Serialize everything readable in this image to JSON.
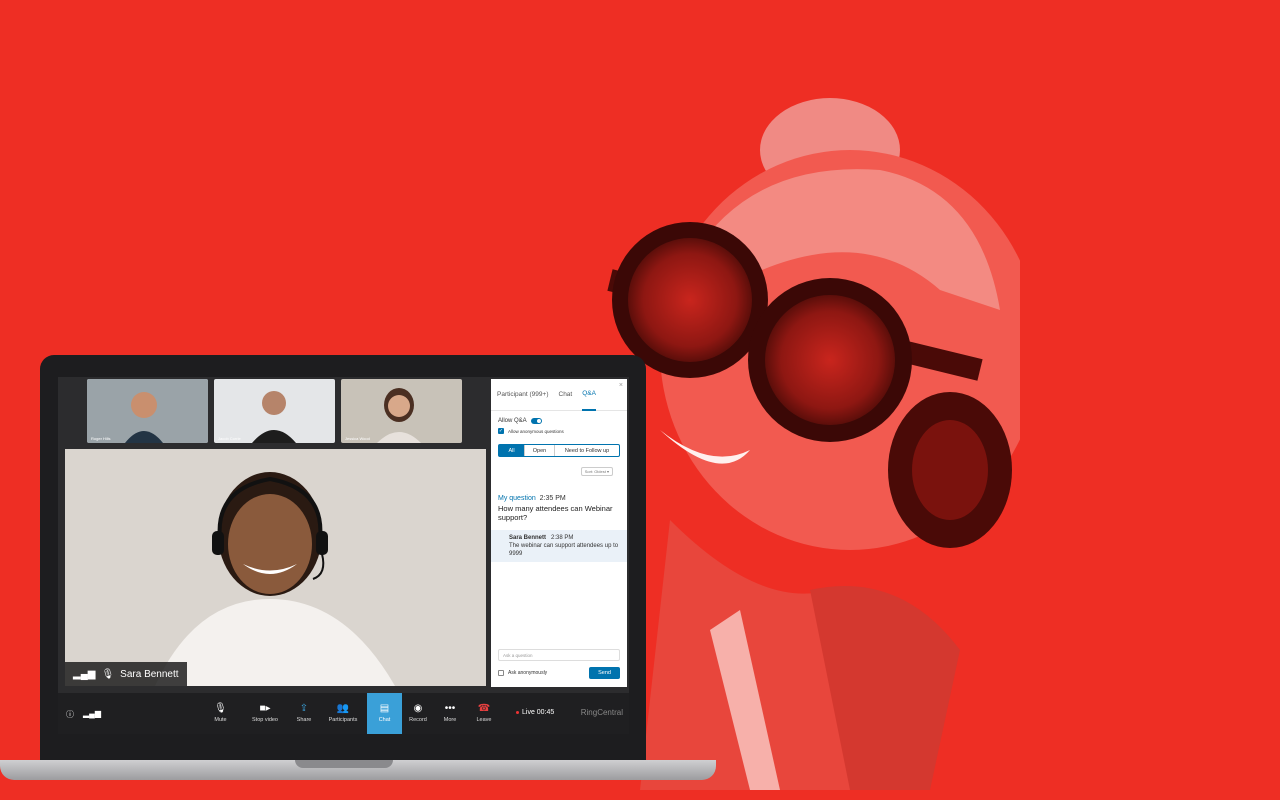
{
  "background_color": "#ee2e24",
  "thumbnails": [
    {
      "label": "Roger Hills"
    },
    {
      "label": "Jacob Corrie"
    },
    {
      "label": "Jessica Wood"
    }
  ],
  "main_speaker": {
    "name": "Sara Bennett"
  },
  "panel": {
    "tabs": [
      {
        "label": "Participant (999+)",
        "active": false
      },
      {
        "label": "Chat",
        "active": false
      },
      {
        "label": "Q&A",
        "active": true
      }
    ],
    "allow_qa_label": "Allow Q&A",
    "allow_anonymous_label": "Allow anonymous questions",
    "filters": [
      {
        "label": "All",
        "active": true
      },
      {
        "label": "Open",
        "active": false
      },
      {
        "label": "Need to Follow up",
        "active": false
      }
    ],
    "sort_label": "Sort: Oldest ▾",
    "question": {
      "prefix": "My question",
      "time": "2:35 PM",
      "text": "How many attendees can Webinar support?"
    },
    "answer": {
      "author": "Sara Bennett",
      "time": "2:38 PM",
      "text": "The webinar can support attendees up to 9999"
    },
    "ask_placeholder": "Ask a question",
    "ask_anonymously_label": "Ask anonymously",
    "send_label": "Send"
  },
  "toolbar": {
    "buttons": [
      {
        "label": "Mute",
        "icon": "mic-icon"
      },
      {
        "label": "Stop video",
        "icon": "video-icon"
      },
      {
        "label": "Share",
        "icon": "share-icon"
      },
      {
        "label": "Participants",
        "icon": "participants-icon"
      },
      {
        "label": "Chat",
        "icon": "chat-icon",
        "selected": true
      },
      {
        "label": "Record",
        "icon": "record-icon"
      },
      {
        "label": "More",
        "icon": "more-icon"
      },
      {
        "label": "Leave",
        "icon": "leave-icon"
      }
    ],
    "live_label": "Live 00:45",
    "brand": "RingCentral"
  }
}
